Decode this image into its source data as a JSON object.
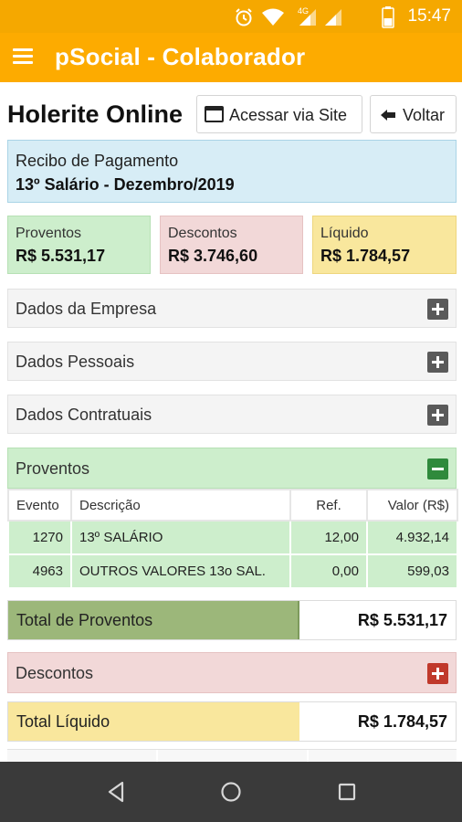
{
  "status_bar": {
    "time": "15:47",
    "network": "4G",
    "icons": [
      "alarm-icon",
      "wifi-icon",
      "signal-icon",
      "signal-icon",
      "battery-icon"
    ]
  },
  "app_bar": {
    "title": "pSocial - Colaborador",
    "menu_icon": "hamburger-menu-icon"
  },
  "header": {
    "title": "Holerite Online",
    "site_button": "Acessar via Site",
    "back_button": "Voltar"
  },
  "receipt": {
    "line1": "Recibo de Pagamento",
    "line2": "13º Salário - Dezembro/2019"
  },
  "summary": {
    "proventos": {
      "label": "Proventos",
      "value": "R$ 5.531,17"
    },
    "descontos": {
      "label": "Descontos",
      "value": "R$ 3.746,60"
    },
    "liquido": {
      "label": "Líquido",
      "value": "R$ 1.784,57"
    }
  },
  "sections": {
    "empresa": "Dados da Empresa",
    "pessoais": "Dados Pessoais",
    "contratuais": "Dados Contratuais",
    "proventos": "Proventos",
    "descontos": "Descontos"
  },
  "proventos_table": {
    "columns": [
      "Evento",
      "Descrição",
      "Ref.",
      "Valor (R$)"
    ],
    "rows": [
      {
        "evento": "1270",
        "descricao": "13º SALÁRIO",
        "ref": "12,00",
        "valor": "4.932,14"
      },
      {
        "evento": "4963",
        "descricao": "OUTROS VALORES 13o SAL.",
        "ref": "0,00",
        "valor": "599,03"
      }
    ]
  },
  "totals": {
    "proventos": {
      "label": "Total de Proventos",
      "value": "R$ 5.531,17"
    },
    "liquido": {
      "label": "Total Líquido",
      "value": "R$ 1.784,57"
    }
  },
  "colors": {
    "app_bar": "#fdab00",
    "proventos": "#cdeecc",
    "descontos": "#f2d8d8",
    "liquido": "#f9e79d",
    "receipt": "#d7edf6",
    "total_proventos": "#9cb77a",
    "nav_bar": "#3a3a3a"
  }
}
